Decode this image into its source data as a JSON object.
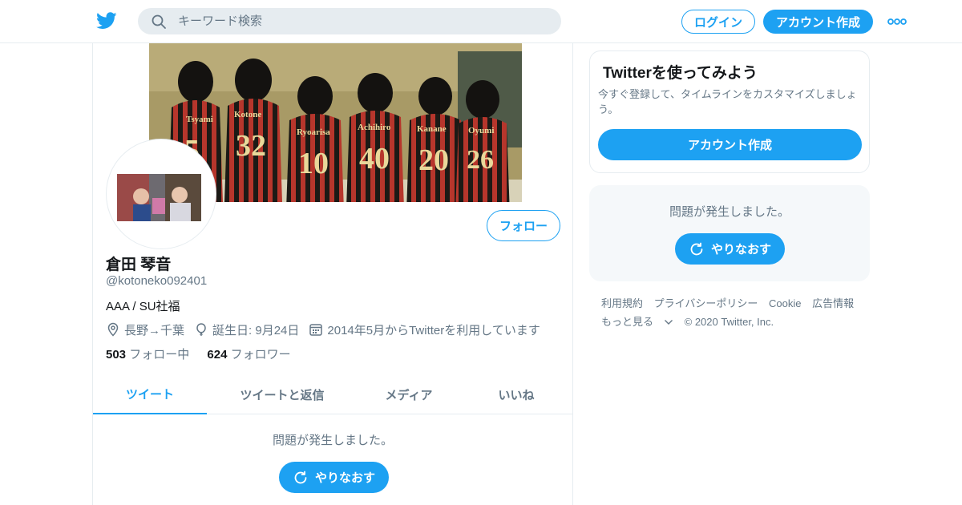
{
  "header": {
    "search_placeholder": "キーワード検索",
    "login_label": "ログイン",
    "signup_label": "アカウント作成"
  },
  "profile": {
    "name": "倉田 琴音",
    "handle": "@kotoneko092401",
    "bio": "AAA / SU社福",
    "location": "長野→千葉",
    "birthday": "誕生日: 9月24日",
    "joined": "2014年5月からTwitterを利用しています",
    "following_count": "503",
    "following_label": "フォロー中",
    "followers_count": "624",
    "followers_label": "フォロワー",
    "follow_label": "フォロー"
  },
  "tabs": [
    {
      "label": "ツイート"
    },
    {
      "label": "ツイートと返信"
    },
    {
      "label": "メディア"
    },
    {
      "label": "いいね"
    }
  ],
  "timeline": {
    "error": "問題が発生しました。",
    "retry": "やりなおす"
  },
  "sidebar": {
    "card_title": "Twitterを使ってみよう",
    "card_desc": "今すぐ登録して、タイムラインをカスタマイズしましょう。",
    "card_button": "アカウント作成",
    "error": "問題が発生しました。",
    "retry": "やりなおす"
  },
  "footer": {
    "links": [
      "利用規約",
      "プライバシーポリシー",
      "Cookie",
      "広告情報"
    ],
    "more": "もっと見る",
    "copyright": "© 2020 Twitter, Inc."
  },
  "banner_jerseys": [
    {
      "name": "Tsyami",
      "number": "5"
    },
    {
      "name": "Kotone",
      "number": "32"
    },
    {
      "name": "Ryoarisa",
      "number": "10"
    },
    {
      "name": "Achihiro",
      "number": "40"
    },
    {
      "name": "Kanane",
      "number": "20"
    },
    {
      "name": "Oyumi",
      "number": "26"
    }
  ],
  "colors": {
    "accent": "#1da1f2",
    "text": "#14171a",
    "muted": "#657786",
    "border": "#e6ecf0",
    "panel": "#f5f8fa"
  }
}
